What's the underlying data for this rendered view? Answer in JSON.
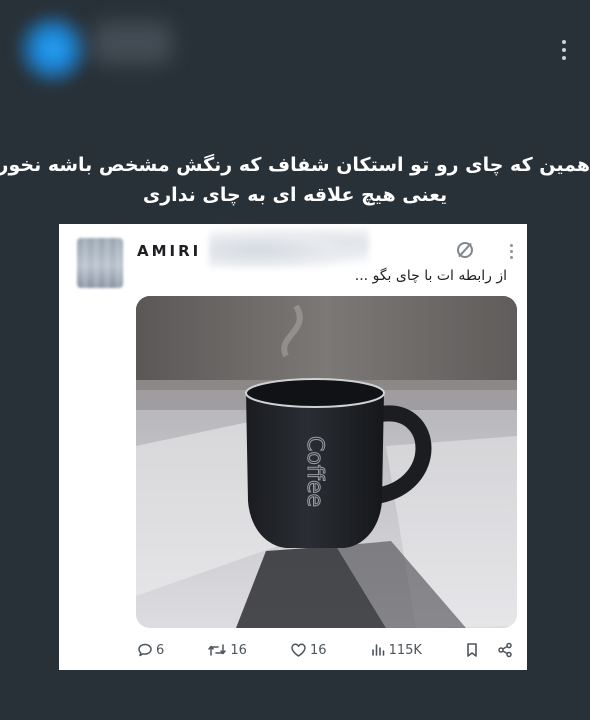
{
  "caption": {
    "line1": "همین که چای رو تو استکان شفاف که رنگش مشخص باشه نخوری",
    "line2": "یعنی هیچ علاقه ای به چای نداری"
  },
  "tweet": {
    "author_name": "AMIRI",
    "text": "از رابطه ات با چای بگو ...",
    "image_text": "Coffee",
    "stats": {
      "replies": "6",
      "retweets": "16",
      "likes": "16",
      "views": "115K"
    }
  },
  "icons": {
    "top_menu": "kebab-icon",
    "brand": "no-symbol-logo-icon",
    "reply": "comment-icon",
    "retweet": "retweet-icon",
    "like": "heart-icon",
    "views": "bar-chart-icon",
    "bookmark": "bookmark-icon",
    "share": "share-icon"
  },
  "colors": {
    "background": "#283138",
    "card": "#ffffff",
    "caption_text": "#ffffff",
    "action_text": "#4d555c",
    "accent_blue": "#1c86d8"
  }
}
